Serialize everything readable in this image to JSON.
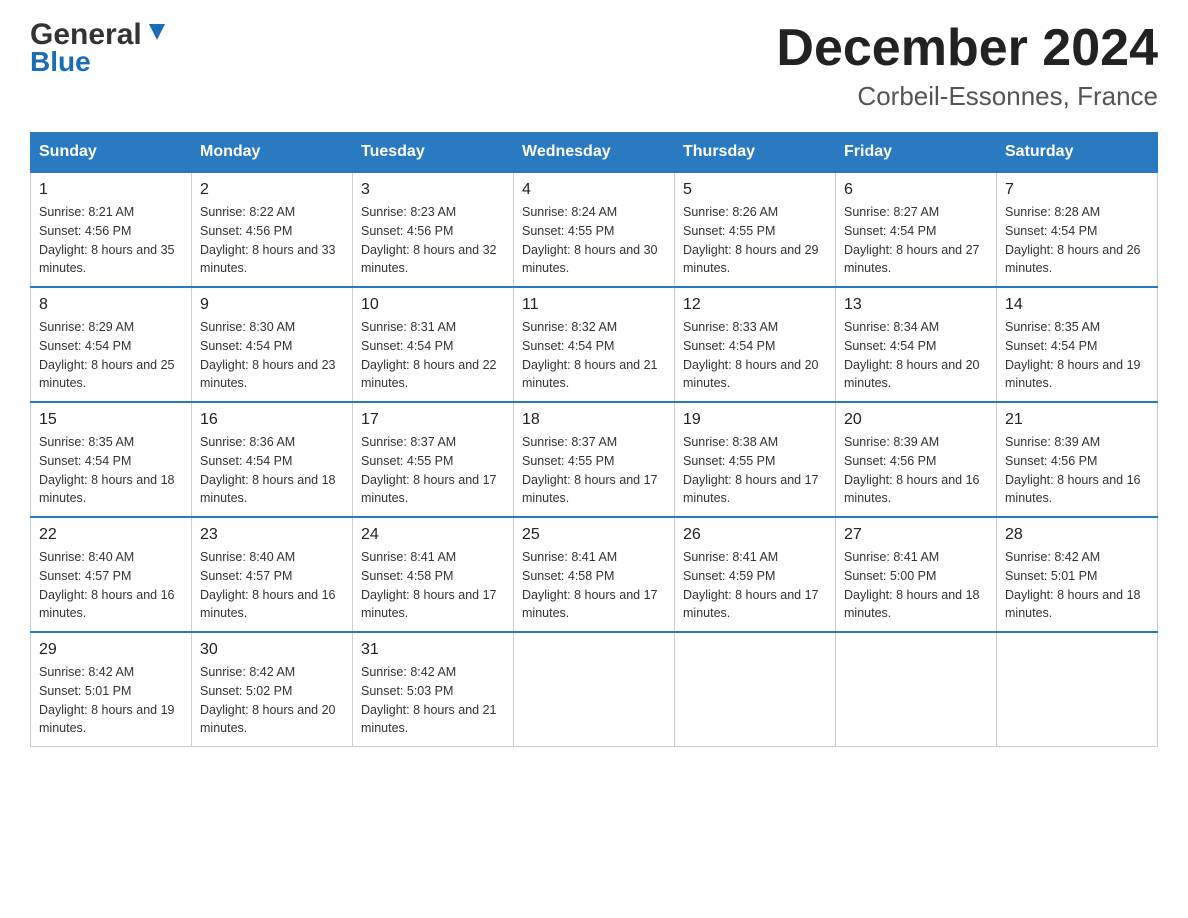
{
  "logo": {
    "general": "General",
    "blue": "Blue"
  },
  "title": "December 2024",
  "subtitle": "Corbeil-Essonnes, France",
  "days_of_week": [
    "Sunday",
    "Monday",
    "Tuesday",
    "Wednesday",
    "Thursday",
    "Friday",
    "Saturday"
  ],
  "weeks": [
    [
      {
        "date": "1",
        "sunrise": "8:21 AM",
        "sunset": "4:56 PM",
        "daylight": "8 hours and 35 minutes."
      },
      {
        "date": "2",
        "sunrise": "8:22 AM",
        "sunset": "4:56 PM",
        "daylight": "8 hours and 33 minutes."
      },
      {
        "date": "3",
        "sunrise": "8:23 AM",
        "sunset": "4:56 PM",
        "daylight": "8 hours and 32 minutes."
      },
      {
        "date": "4",
        "sunrise": "8:24 AM",
        "sunset": "4:55 PM",
        "daylight": "8 hours and 30 minutes."
      },
      {
        "date": "5",
        "sunrise": "8:26 AM",
        "sunset": "4:55 PM",
        "daylight": "8 hours and 29 minutes."
      },
      {
        "date": "6",
        "sunrise": "8:27 AM",
        "sunset": "4:54 PM",
        "daylight": "8 hours and 27 minutes."
      },
      {
        "date": "7",
        "sunrise": "8:28 AM",
        "sunset": "4:54 PM",
        "daylight": "8 hours and 26 minutes."
      }
    ],
    [
      {
        "date": "8",
        "sunrise": "8:29 AM",
        "sunset": "4:54 PM",
        "daylight": "8 hours and 25 minutes."
      },
      {
        "date": "9",
        "sunrise": "8:30 AM",
        "sunset": "4:54 PM",
        "daylight": "8 hours and 23 minutes."
      },
      {
        "date": "10",
        "sunrise": "8:31 AM",
        "sunset": "4:54 PM",
        "daylight": "8 hours and 22 minutes."
      },
      {
        "date": "11",
        "sunrise": "8:32 AM",
        "sunset": "4:54 PM",
        "daylight": "8 hours and 21 minutes."
      },
      {
        "date": "12",
        "sunrise": "8:33 AM",
        "sunset": "4:54 PM",
        "daylight": "8 hours and 20 minutes."
      },
      {
        "date": "13",
        "sunrise": "8:34 AM",
        "sunset": "4:54 PM",
        "daylight": "8 hours and 20 minutes."
      },
      {
        "date": "14",
        "sunrise": "8:35 AM",
        "sunset": "4:54 PM",
        "daylight": "8 hours and 19 minutes."
      }
    ],
    [
      {
        "date": "15",
        "sunrise": "8:35 AM",
        "sunset": "4:54 PM",
        "daylight": "8 hours and 18 minutes."
      },
      {
        "date": "16",
        "sunrise": "8:36 AM",
        "sunset": "4:54 PM",
        "daylight": "8 hours and 18 minutes."
      },
      {
        "date": "17",
        "sunrise": "8:37 AM",
        "sunset": "4:55 PM",
        "daylight": "8 hours and 17 minutes."
      },
      {
        "date": "18",
        "sunrise": "8:37 AM",
        "sunset": "4:55 PM",
        "daylight": "8 hours and 17 minutes."
      },
      {
        "date": "19",
        "sunrise": "8:38 AM",
        "sunset": "4:55 PM",
        "daylight": "8 hours and 17 minutes."
      },
      {
        "date": "20",
        "sunrise": "8:39 AM",
        "sunset": "4:56 PM",
        "daylight": "8 hours and 16 minutes."
      },
      {
        "date": "21",
        "sunrise": "8:39 AM",
        "sunset": "4:56 PM",
        "daylight": "8 hours and 16 minutes."
      }
    ],
    [
      {
        "date": "22",
        "sunrise": "8:40 AM",
        "sunset": "4:57 PM",
        "daylight": "8 hours and 16 minutes."
      },
      {
        "date": "23",
        "sunrise": "8:40 AM",
        "sunset": "4:57 PM",
        "daylight": "8 hours and 16 minutes."
      },
      {
        "date": "24",
        "sunrise": "8:41 AM",
        "sunset": "4:58 PM",
        "daylight": "8 hours and 17 minutes."
      },
      {
        "date": "25",
        "sunrise": "8:41 AM",
        "sunset": "4:58 PM",
        "daylight": "8 hours and 17 minutes."
      },
      {
        "date": "26",
        "sunrise": "8:41 AM",
        "sunset": "4:59 PM",
        "daylight": "8 hours and 17 minutes."
      },
      {
        "date": "27",
        "sunrise": "8:41 AM",
        "sunset": "5:00 PM",
        "daylight": "8 hours and 18 minutes."
      },
      {
        "date": "28",
        "sunrise": "8:42 AM",
        "sunset": "5:01 PM",
        "daylight": "8 hours and 18 minutes."
      }
    ],
    [
      {
        "date": "29",
        "sunrise": "8:42 AM",
        "sunset": "5:01 PM",
        "daylight": "8 hours and 19 minutes."
      },
      {
        "date": "30",
        "sunrise": "8:42 AM",
        "sunset": "5:02 PM",
        "daylight": "8 hours and 20 minutes."
      },
      {
        "date": "31",
        "sunrise": "8:42 AM",
        "sunset": "5:03 PM",
        "daylight": "8 hours and 21 minutes."
      },
      null,
      null,
      null,
      null
    ]
  ],
  "labels": {
    "sunrise": "Sunrise:",
    "sunset": "Sunset:",
    "daylight": "Daylight:"
  }
}
